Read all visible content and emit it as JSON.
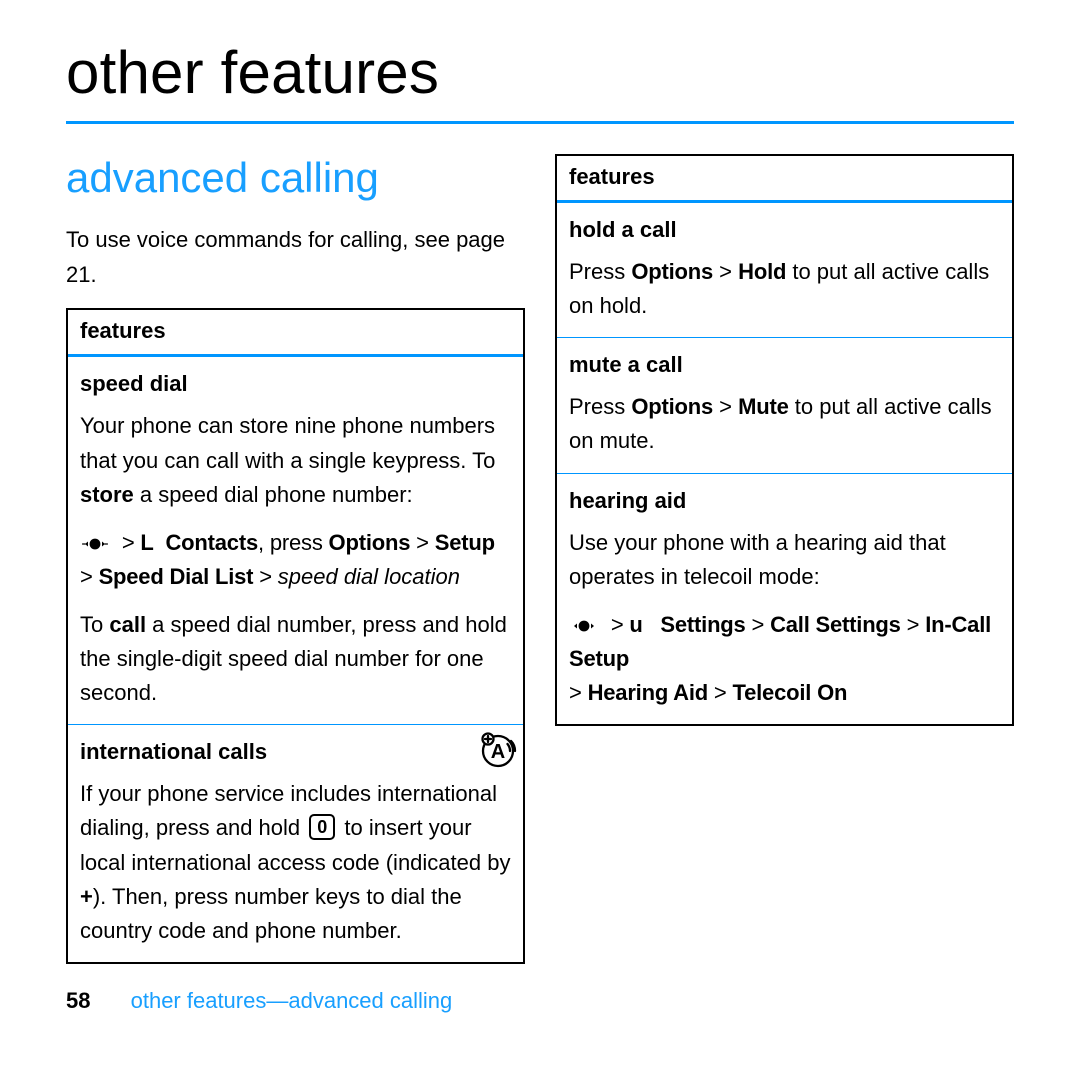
{
  "title": "other features",
  "subheading": "advanced calling",
  "intro": "To use voice commands for calling, see page 21.",
  "leftBox": {
    "header": "features",
    "speedDial": {
      "title": "speed dial",
      "para1_a": "Your phone can store nine phone numbers that you can call with a single keypress. To ",
      "para1_bold": "store",
      "para1_b": " a speed dial phone number:",
      "path1_menu": "L",
      "path1_contacts": "Contacts",
      "path1_press": ", press ",
      "path1_options": "Options",
      "path1_setup": "Setup",
      "path2_sdl": "Speed Dial List",
      "path2_loc": "speed dial location",
      "para2_a": "To ",
      "para2_bold": "call",
      "para2_b": " a speed dial number, press and hold the single-digit speed dial number for one second."
    },
    "intl": {
      "title": "international calls",
      "para_a": "If your phone service includes international dialing, press and hold ",
      "key": "0",
      "para_b": " to insert your local international access code (indicated by ",
      "plus": "+",
      "para_c": "). Then, press number keys to dial the country code and phone number."
    }
  },
  "rightBox": {
    "header": "features",
    "hold": {
      "title": "hold a call",
      "p_a": "Press ",
      "p_opt": "Options",
      "p_hold": "Hold",
      "p_b": " to put all active calls on hold."
    },
    "mute": {
      "title": "mute a call",
      "p_a": "Press ",
      "p_opt": "Options",
      "p_mute": "Mute",
      "p_b": " to put all active calls on mute."
    },
    "hearing": {
      "title": "hearing aid",
      "para": "Use your phone with a hearing aid that operates in telecoil mode:",
      "path_menu": "u",
      "path_settings": "Settings",
      "path_call": "Call Settings",
      "path_incall": "In-Call Setup",
      "path_ha": "Hearing Aid",
      "path_tc": "Telecoil On"
    }
  },
  "footer": {
    "pageNum": "58",
    "label": "other features—advanced calling"
  }
}
